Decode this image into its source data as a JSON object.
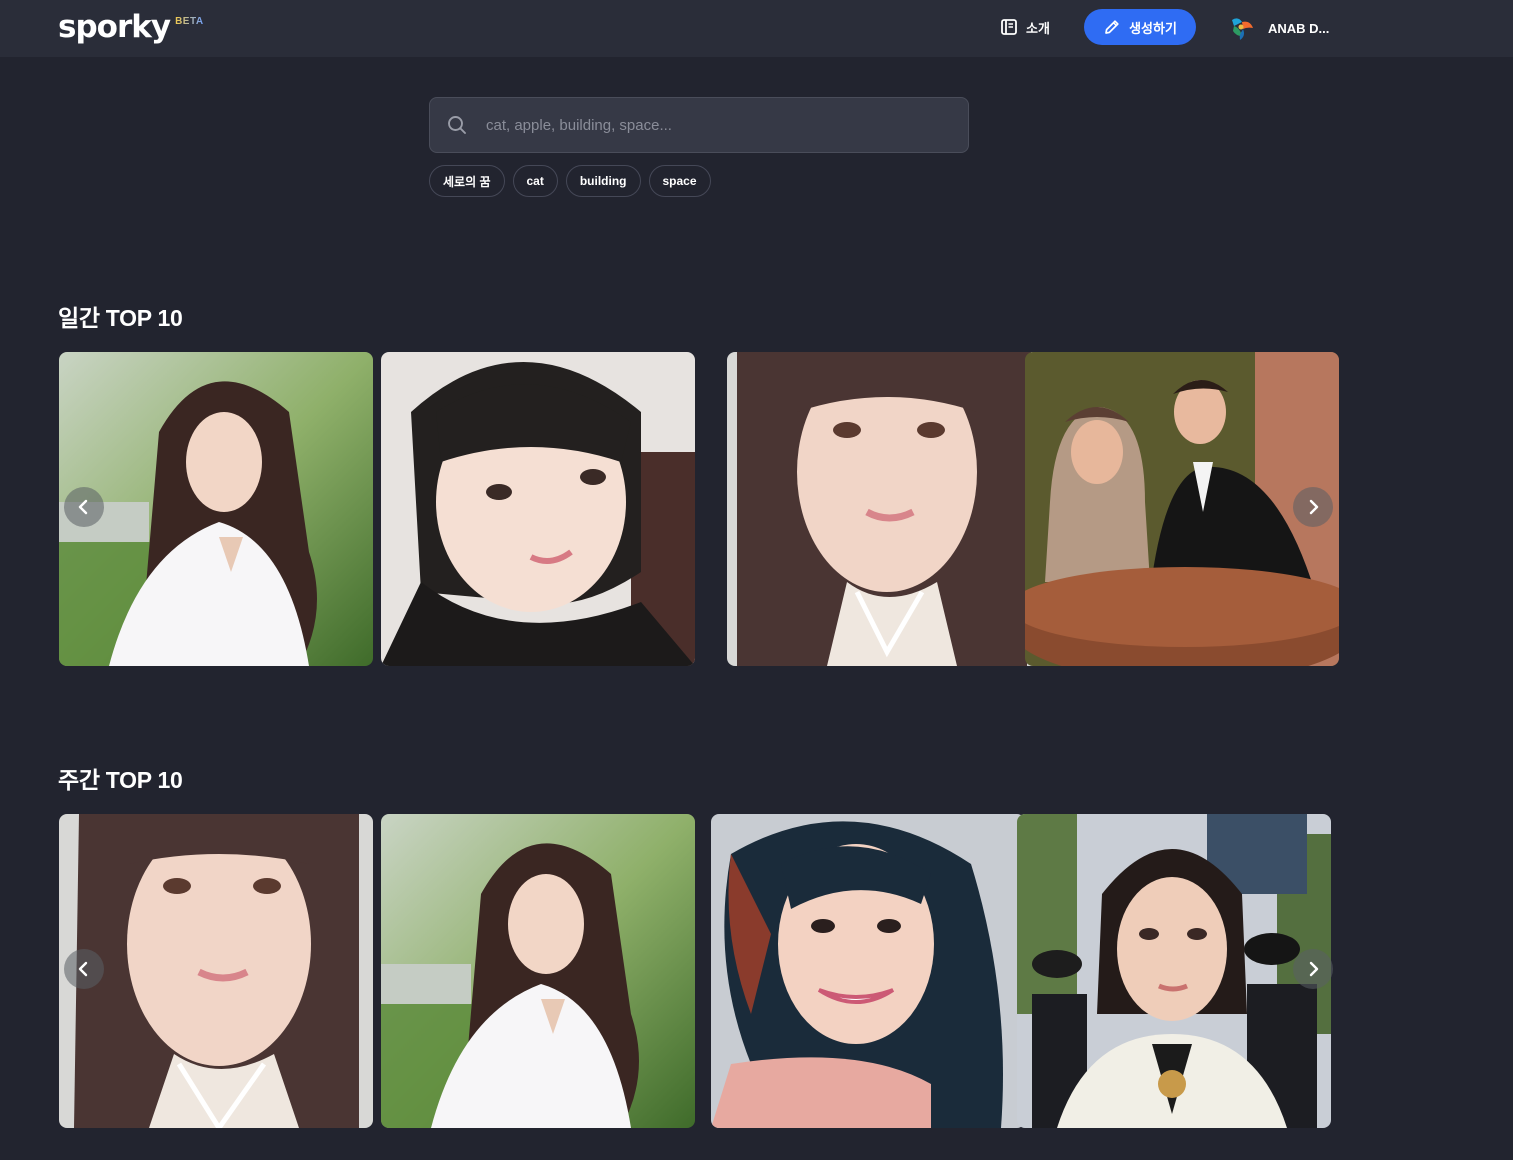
{
  "header": {
    "logo": "sporky",
    "beta": "BETA",
    "nav_about": "소개",
    "create_button": "생성하기",
    "user_name": "ANAB D..."
  },
  "search": {
    "placeholder": "cat, apple, building, space...",
    "chips": [
      "세로의 꿈",
      "cat",
      "building",
      "space"
    ]
  },
  "sections": [
    {
      "title": "일간 TOP 10",
      "images": [
        "portrait-woman-white-blouse-garden",
        "portrait-woman-bob-haircut",
        "portrait-woman-long-hair-closeup",
        "vintage-couple-at-table"
      ]
    },
    {
      "title": "주간 TOP 10",
      "images": [
        "portrait-woman-long-hair-closeup",
        "portrait-woman-white-blouse-garden",
        "portrait-woman-smiling-dark-hair",
        "portrait-woman-white-jacket-crowd"
      ]
    }
  ],
  "icons": {
    "about": "book-icon",
    "create": "pencil-icon",
    "search": "search-icon",
    "prev": "chevron-left-icon",
    "next": "chevron-right-icon"
  },
  "colors": {
    "background": "#22242f",
    "header": "#2a2d39",
    "accent": "#2f6cf3"
  }
}
